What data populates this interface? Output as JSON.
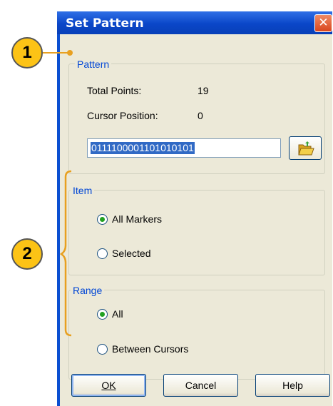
{
  "dialog": {
    "title": "Set Pattern",
    "close_glyph": "✕"
  },
  "pattern_group": {
    "label": "Pattern",
    "total_points_label": "Total Points:",
    "total_points_value": "19",
    "cursor_position_label": "Cursor Position:",
    "cursor_position_value": "0",
    "pattern_value": "0111100001101010101"
  },
  "item_group": {
    "label": "Item",
    "options": [
      {
        "label": "All Markers",
        "selected": true
      },
      {
        "label": "Selected",
        "selected": false
      }
    ]
  },
  "range_group": {
    "label": "Range",
    "options": [
      {
        "label": "All",
        "selected": true
      },
      {
        "label": "Between Cursors",
        "selected": false
      }
    ]
  },
  "buttons": {
    "ok_label": "OK",
    "cancel_label": "Cancel",
    "help_label": "Help"
  },
  "callouts": {
    "one": "1",
    "two": "2"
  },
  "colors": {
    "titlebar": "#0a46c8",
    "group_label": "#0046d5",
    "callout_fill": "#fcc316",
    "callout_line": "#e8a020",
    "radio_selected": "#21a121"
  }
}
